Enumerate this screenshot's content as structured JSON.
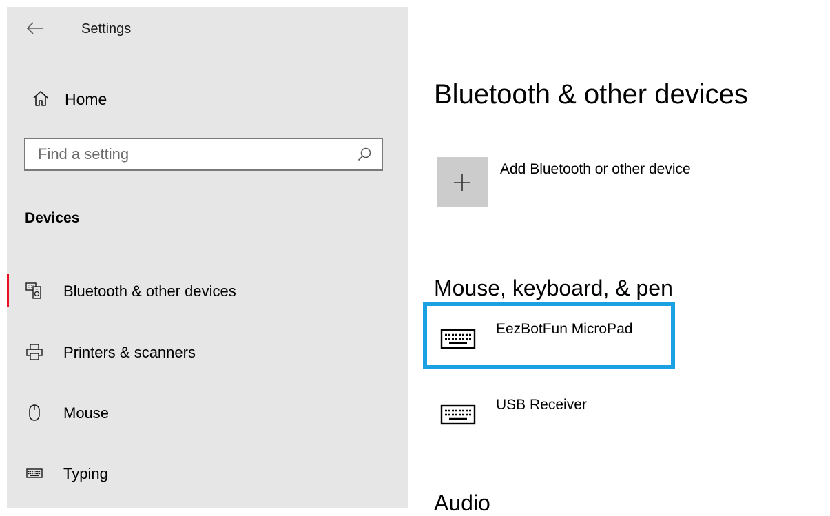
{
  "sidebar": {
    "app_title": "Settings",
    "home_label": "Home",
    "search_placeholder": "Find a setting",
    "section_title": "Devices",
    "items": [
      {
        "label": "Bluetooth & other devices",
        "icon": "bluetooth-devices-icon",
        "selected": true
      },
      {
        "label": "Printers & scanners",
        "icon": "printer-icon",
        "selected": false
      },
      {
        "label": "Mouse",
        "icon": "mouse-icon",
        "selected": false
      },
      {
        "label": "Typing",
        "icon": "keyboard-icon",
        "selected": false
      }
    ]
  },
  "main": {
    "page_title": "Bluetooth & other devices",
    "add_device_label": "Add Bluetooth or other device",
    "section_mouse_keyboard": "Mouse, keyboard, & pen",
    "devices": [
      {
        "name": "EezBotFun MicroPad",
        "icon": "keyboard-icon",
        "highlighted": true
      },
      {
        "name": "USB Receiver",
        "icon": "keyboard-icon",
        "highlighted": false
      }
    ],
    "next_section_partial": "Audio"
  },
  "colors": {
    "sidebar_bg": "#e6e6e6",
    "selected_indicator": "#e81123",
    "highlight_border": "#1ba1e2",
    "add_tile_bg": "#cccccc"
  }
}
